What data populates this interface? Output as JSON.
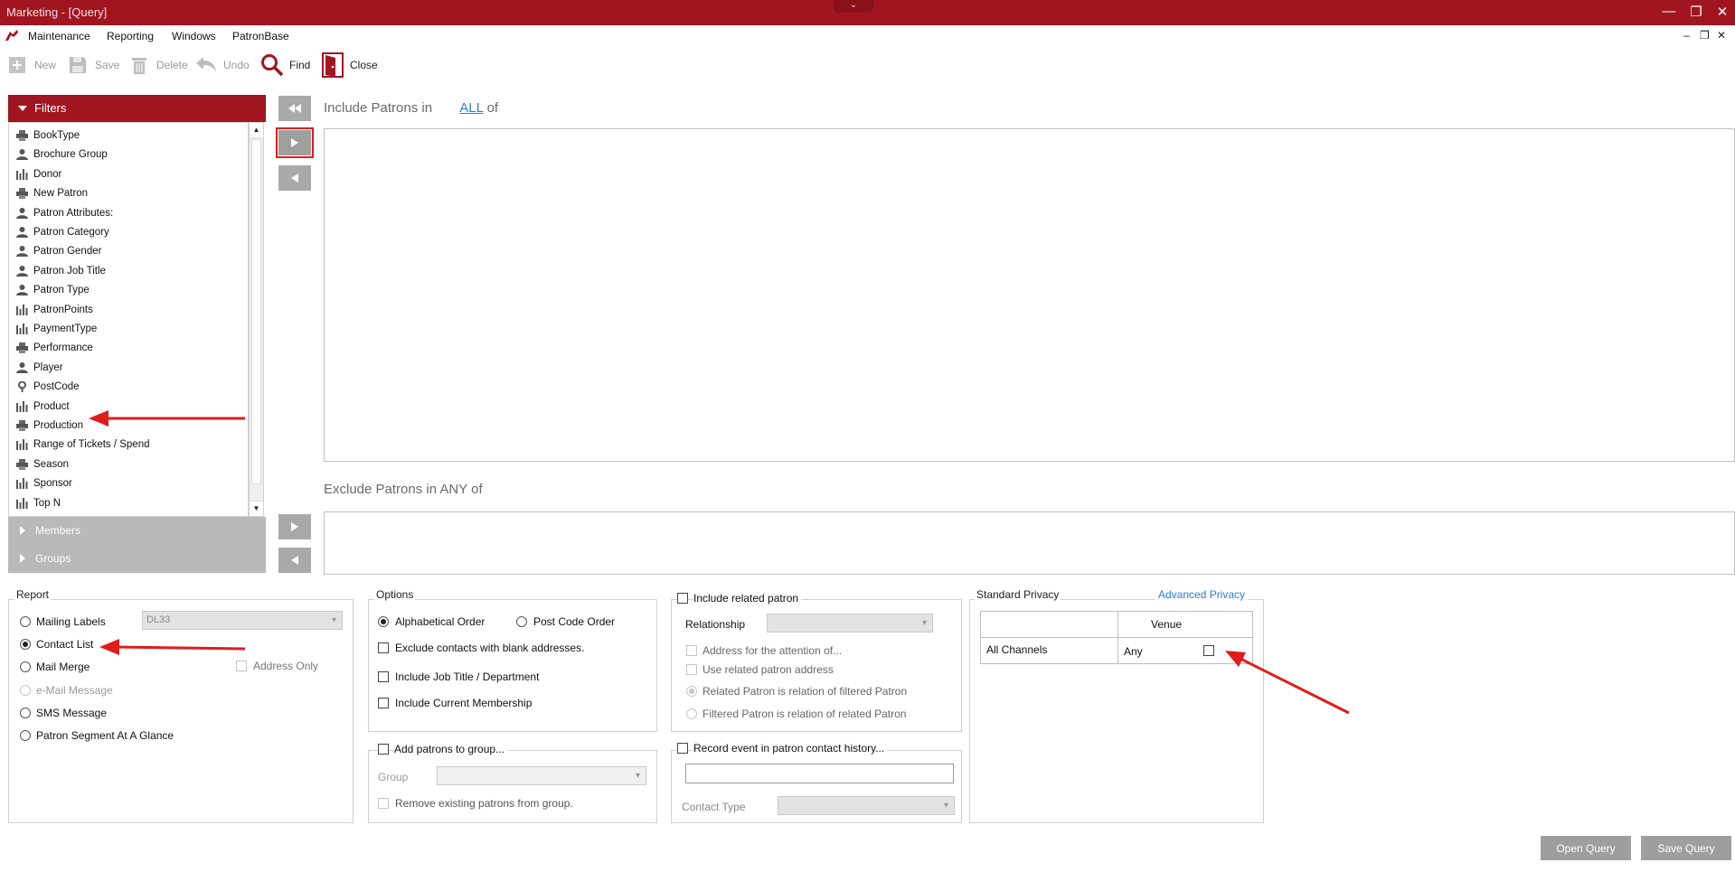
{
  "window": {
    "title": "Marketing - [Query]",
    "notch_glyph": "⌄",
    "minimize_glyph": "—",
    "restore_glyph": "❐",
    "close_glyph": "✕"
  },
  "menubar": {
    "items": [
      "Maintenance",
      "Reporting",
      "Windows",
      "PatronBase"
    ],
    "mdi_minimize": "–",
    "mdi_restore": "❐",
    "mdi_close": "✕"
  },
  "toolbar": {
    "new": "New",
    "save": "Save",
    "delete": "Delete",
    "undo": "Undo",
    "find": "Find",
    "close": "Close"
  },
  "filters": {
    "header": "Filters",
    "items": [
      {
        "label": "BookType",
        "icon": "printer-icon"
      },
      {
        "label": "Brochure Group",
        "icon": "person-icon"
      },
      {
        "label": "Donor",
        "icon": "bar-chart-icon"
      },
      {
        "label": "New Patron",
        "icon": "printer-icon"
      },
      {
        "label": "Patron Attributes:",
        "icon": "person-icon"
      },
      {
        "label": "Patron Category",
        "icon": "person-icon"
      },
      {
        "label": "Patron Gender",
        "icon": "person-icon"
      },
      {
        "label": "Patron Job Title",
        "icon": "person-icon"
      },
      {
        "label": "Patron Type",
        "icon": "person-icon"
      },
      {
        "label": "PatronPoints",
        "icon": "bar-chart-icon"
      },
      {
        "label": "PaymentType",
        "icon": "bar-chart-icon"
      },
      {
        "label": "Performance",
        "icon": "printer-icon"
      },
      {
        "label": "Player",
        "icon": "person-icon"
      },
      {
        "label": "PostCode",
        "icon": "pin-icon"
      },
      {
        "label": "Product",
        "icon": "bar-chart-icon"
      },
      {
        "label": "Production",
        "icon": "printer-icon"
      },
      {
        "label": "Range of Tickets / Spend",
        "icon": "bar-chart-icon"
      },
      {
        "label": "Season",
        "icon": "printer-icon"
      },
      {
        "label": "Sponsor",
        "icon": "bar-chart-icon"
      },
      {
        "label": "Top N",
        "icon": "bar-chart-icon"
      }
    ],
    "members": "Members",
    "groups": "Groups"
  },
  "include": {
    "prefix": "Include Patrons in",
    "link": "ALL",
    "suffix": "of"
  },
  "exclude": {
    "heading": "Exclude Patrons in ANY of"
  },
  "report": {
    "title": "Report",
    "mailing_labels": "Mailing Labels",
    "label_format": "DL33",
    "contact_list": "Contact List",
    "mail_merge": "Mail Merge",
    "address_only": "Address Only",
    "email_message": "e-Mail Message",
    "sms_message": "SMS Message",
    "segment": "Patron Segment At A Glance"
  },
  "options": {
    "title": "Options",
    "alphabetical": "Alphabetical Order",
    "postcode_order": "Post Code Order",
    "exclude_blank": "Exclude contacts with blank addresses.",
    "job_title": "Include Job Title / Department",
    "membership": "Include Current Membership"
  },
  "group_box": {
    "add_patrons": "Add patrons to group...",
    "group_label": "Group",
    "remove_existing": "Remove existing patrons from group."
  },
  "related": {
    "include": "Include related patron",
    "relationship": "Relationship",
    "attention": "Address for the attention of...",
    "use_address": "Use related patron address",
    "rel_of_filtered": "Related Patron is relation of filtered Patron",
    "filtered_of_rel": "Filtered Patron is relation of related Patron"
  },
  "record_event": {
    "label": "Record event in patron contact history...",
    "contact_type": "Contact Type"
  },
  "privacy": {
    "standard": "Standard Privacy",
    "advanced": "Advanced Privacy",
    "venue_header": "Venue",
    "row_label": "All Channels",
    "row_value": "Any"
  },
  "buttons": {
    "open_query": "Open Query",
    "save_query": "Save Query"
  },
  "colors": {
    "brand": "#a11520",
    "annotation_arrow": "#e01c1c"
  }
}
